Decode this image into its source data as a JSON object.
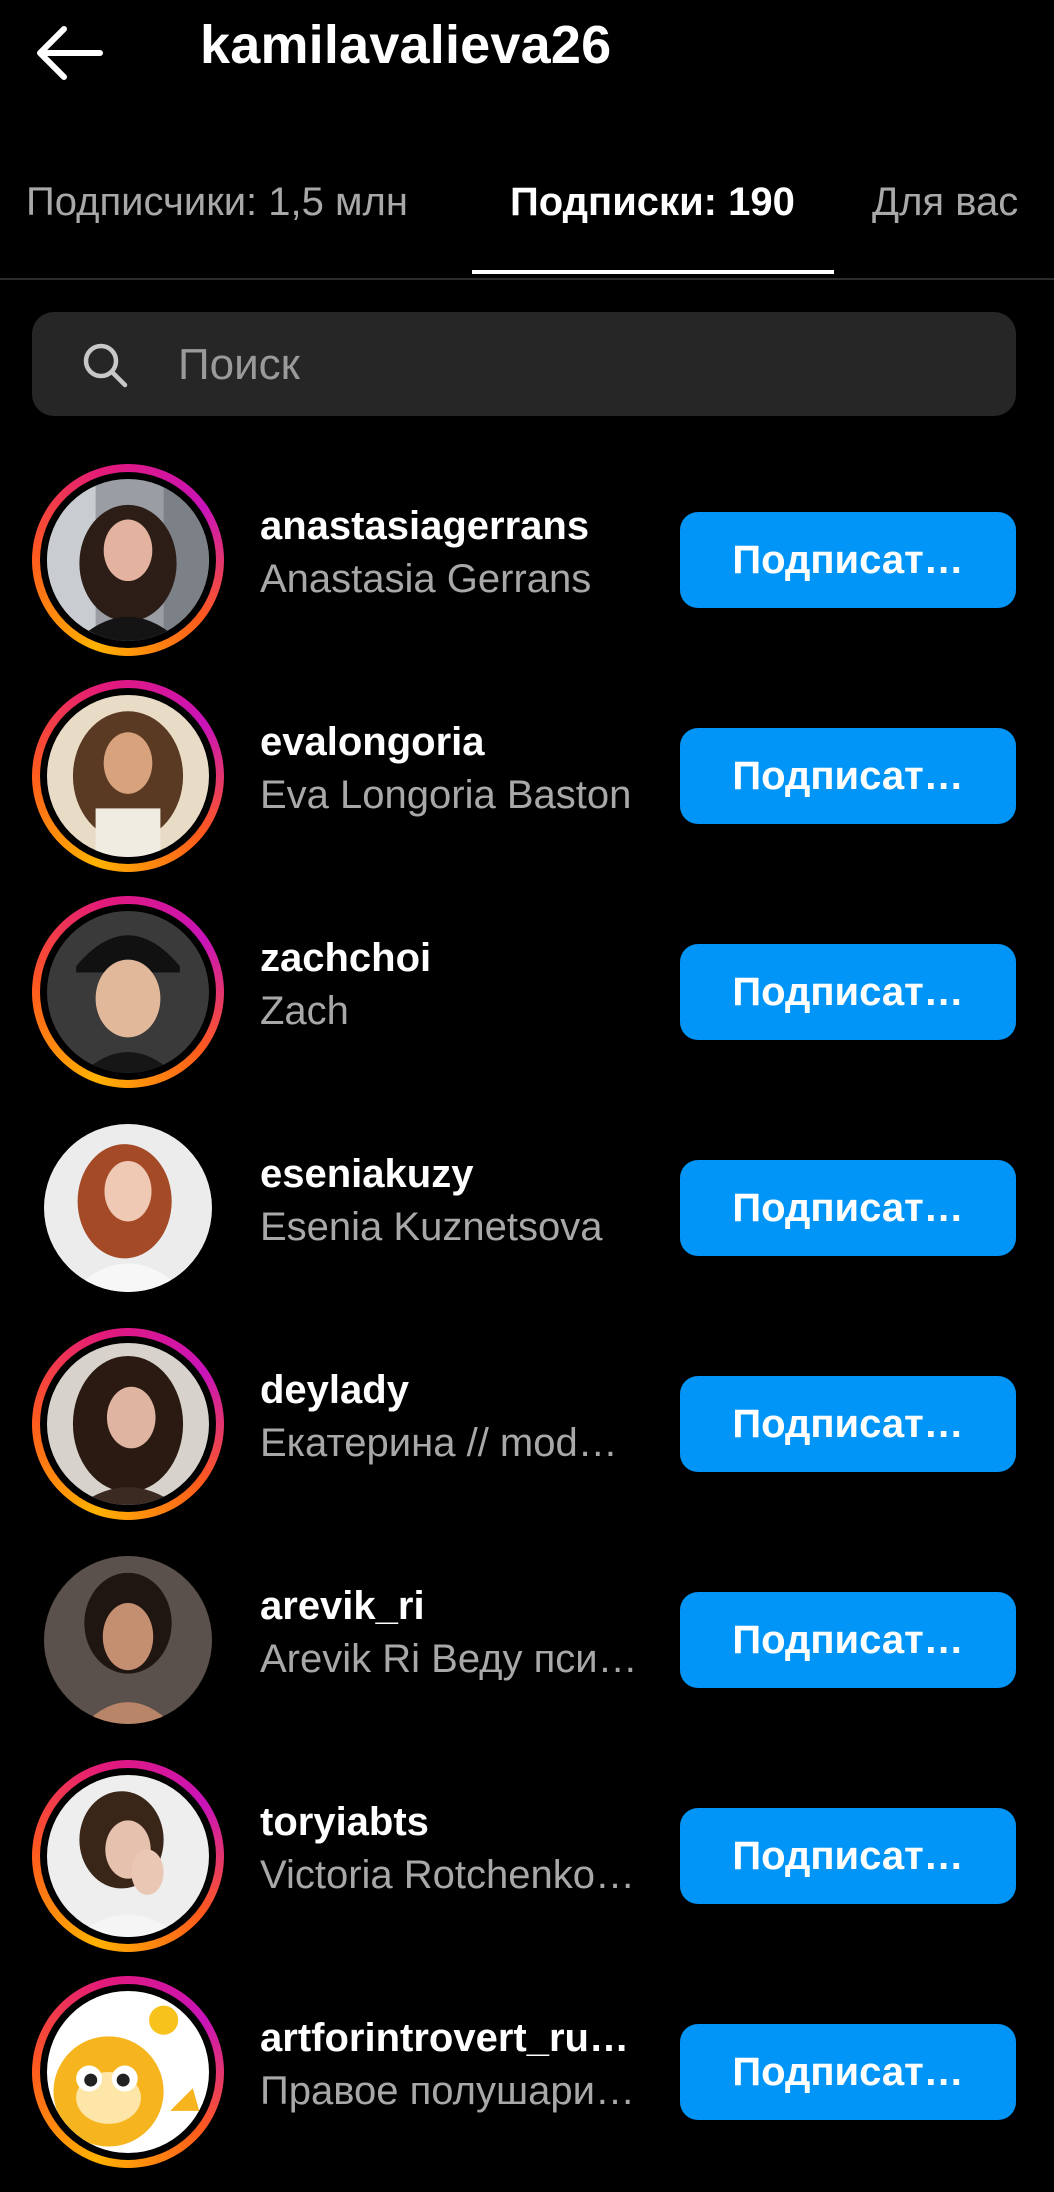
{
  "header": {
    "title": "kamilavalieva26",
    "back_icon": "arrow-left-icon"
  },
  "tabs": [
    {
      "label": "Подписчики: 1,5 млн",
      "active": false
    },
    {
      "label": "Подписки: 190",
      "active": true
    },
    {
      "label": "Для вас",
      "active": false
    }
  ],
  "search": {
    "placeholder": "Поиск",
    "value": "",
    "icon": "search-icon"
  },
  "colors": {
    "accent": "#0095f6",
    "background": "#000000",
    "secondary_text": "#a8a8a8",
    "search_bg": "#262626"
  },
  "users": [
    {
      "username": "anastasiagerrans",
      "fullname": "Anastasia Gerrans",
      "button": "Подписат…",
      "story_ring": true
    },
    {
      "username": "evalongoria",
      "fullname": "Eva Longoria Baston",
      "button": "Подписат…",
      "story_ring": true
    },
    {
      "username": "zachchoi",
      "fullname": "Zach",
      "button": "Подписат…",
      "story_ring": true
    },
    {
      "username": "eseniakuzy",
      "fullname": "Esenia Kuznetsova",
      "button": "Подписат…",
      "story_ring": false
    },
    {
      "username": "deylady",
      "fullname": "Екатерина // mod…",
      "button": "Подписат…",
      "story_ring": true
    },
    {
      "username": "arevik_ri",
      "fullname": "Arevik Ri Веду пси…",
      "button": "Подписат…",
      "story_ring": false
    },
    {
      "username": "toryiabts",
      "fullname": "Victoria Rotchenko…",
      "button": "Подписат…",
      "story_ring": true
    },
    {
      "username": "artforintrovert_rus…",
      "fullname": "Правое полушари…",
      "button": "Подписат…",
      "story_ring": true
    }
  ]
}
